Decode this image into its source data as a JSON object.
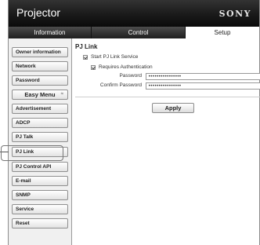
{
  "app": {
    "title": "Projector",
    "brand": "SONY"
  },
  "tabs": [
    {
      "label": "Information",
      "active": false
    },
    {
      "label": "Control",
      "active": false
    },
    {
      "label": "Setup",
      "active": true
    }
  ],
  "sidebar": {
    "items": [
      {
        "label": "Owner information"
      },
      {
        "label": "Network"
      },
      {
        "label": "Password"
      },
      {
        "label": "Easy Menu",
        "group": true,
        "caret": "≈"
      },
      {
        "label": "Advertisement"
      },
      {
        "label": "ADCP"
      },
      {
        "label": "PJ Talk"
      },
      {
        "label": "PJ Link",
        "selected": true
      },
      {
        "label": "PJ Control API"
      },
      {
        "label": "E-mail"
      },
      {
        "label": "SNMP"
      },
      {
        "label": "Service"
      },
      {
        "label": "Reset"
      }
    ]
  },
  "main": {
    "section_title": "PJ Link",
    "start_service": {
      "label": "Start PJ Link Service",
      "checked": true
    },
    "requires_auth": {
      "label": "Requires Authentication",
      "checked": true
    },
    "password": {
      "label": "Password",
      "value": "••••••••••••••••"
    },
    "confirm_password": {
      "label": "Confirm Password",
      "value": "••••••••••••••••"
    },
    "apply_label": "Apply"
  },
  "colors": {
    "header_bg": "#1c1c1c",
    "active_tab_bg": "#ffffff",
    "sidebar_bg": "#f0f0f0"
  }
}
